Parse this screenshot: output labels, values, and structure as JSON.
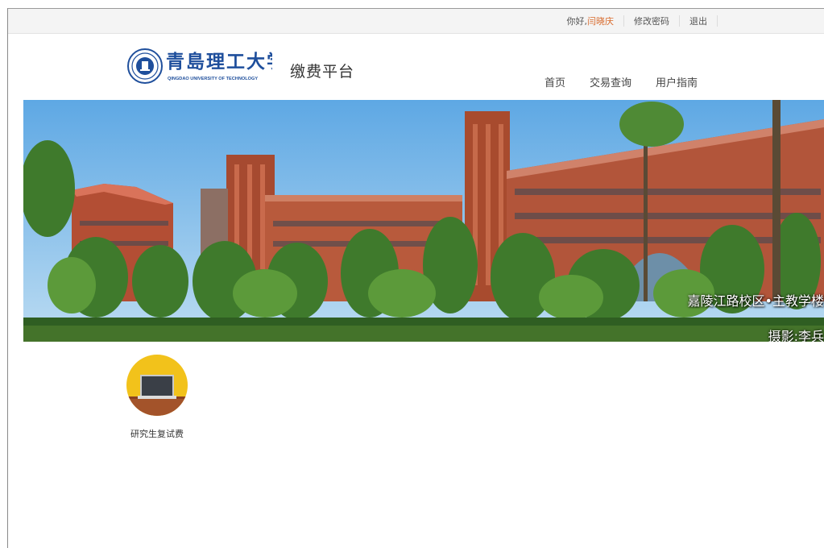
{
  "topbar": {
    "greeting": "你好,",
    "username": "闫晓庆",
    "change_password": "修改密码",
    "logout": "退出"
  },
  "header": {
    "university_name_cn": "青島理工大学",
    "university_name_en": "QINGDAO UNIVERSITY OF TECHNOLOGY",
    "platform_title": "缴费平台"
  },
  "nav": {
    "items": [
      "首页",
      "交易查询",
      "用户指南"
    ]
  },
  "banner": {
    "caption_location": "嘉陵江路校区•主教学楼",
    "caption_photographer": "摄影:李兵"
  },
  "services": [
    {
      "label": "研究生复试费",
      "icon": "blackboard-icon"
    }
  ],
  "colors": {
    "username": "#d8692a",
    "logo_blue": "#1f4f9c",
    "tile_yellow": "#f2c21b",
    "tile_brown": "#a3532a"
  }
}
